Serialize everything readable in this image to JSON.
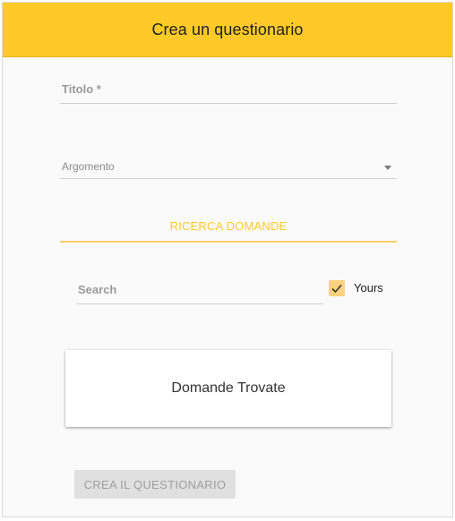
{
  "header": {
    "title": "Crea un questionario"
  },
  "form": {
    "titolo_label": "Titolo *",
    "argomento_label": "Argomento"
  },
  "tab": {
    "label": "RICERCA DOMANDE"
  },
  "search": {
    "label": "Search",
    "yours_label": "Yours",
    "yours_checked": true
  },
  "results": {
    "title": "Domande Trovate"
  },
  "actions": {
    "create_label": "CREA IL QUESTIONARIO"
  },
  "colors": {
    "accent": "#ffca28",
    "checkbox": "#ffd180",
    "button_disabled": "#e0e0e0"
  }
}
